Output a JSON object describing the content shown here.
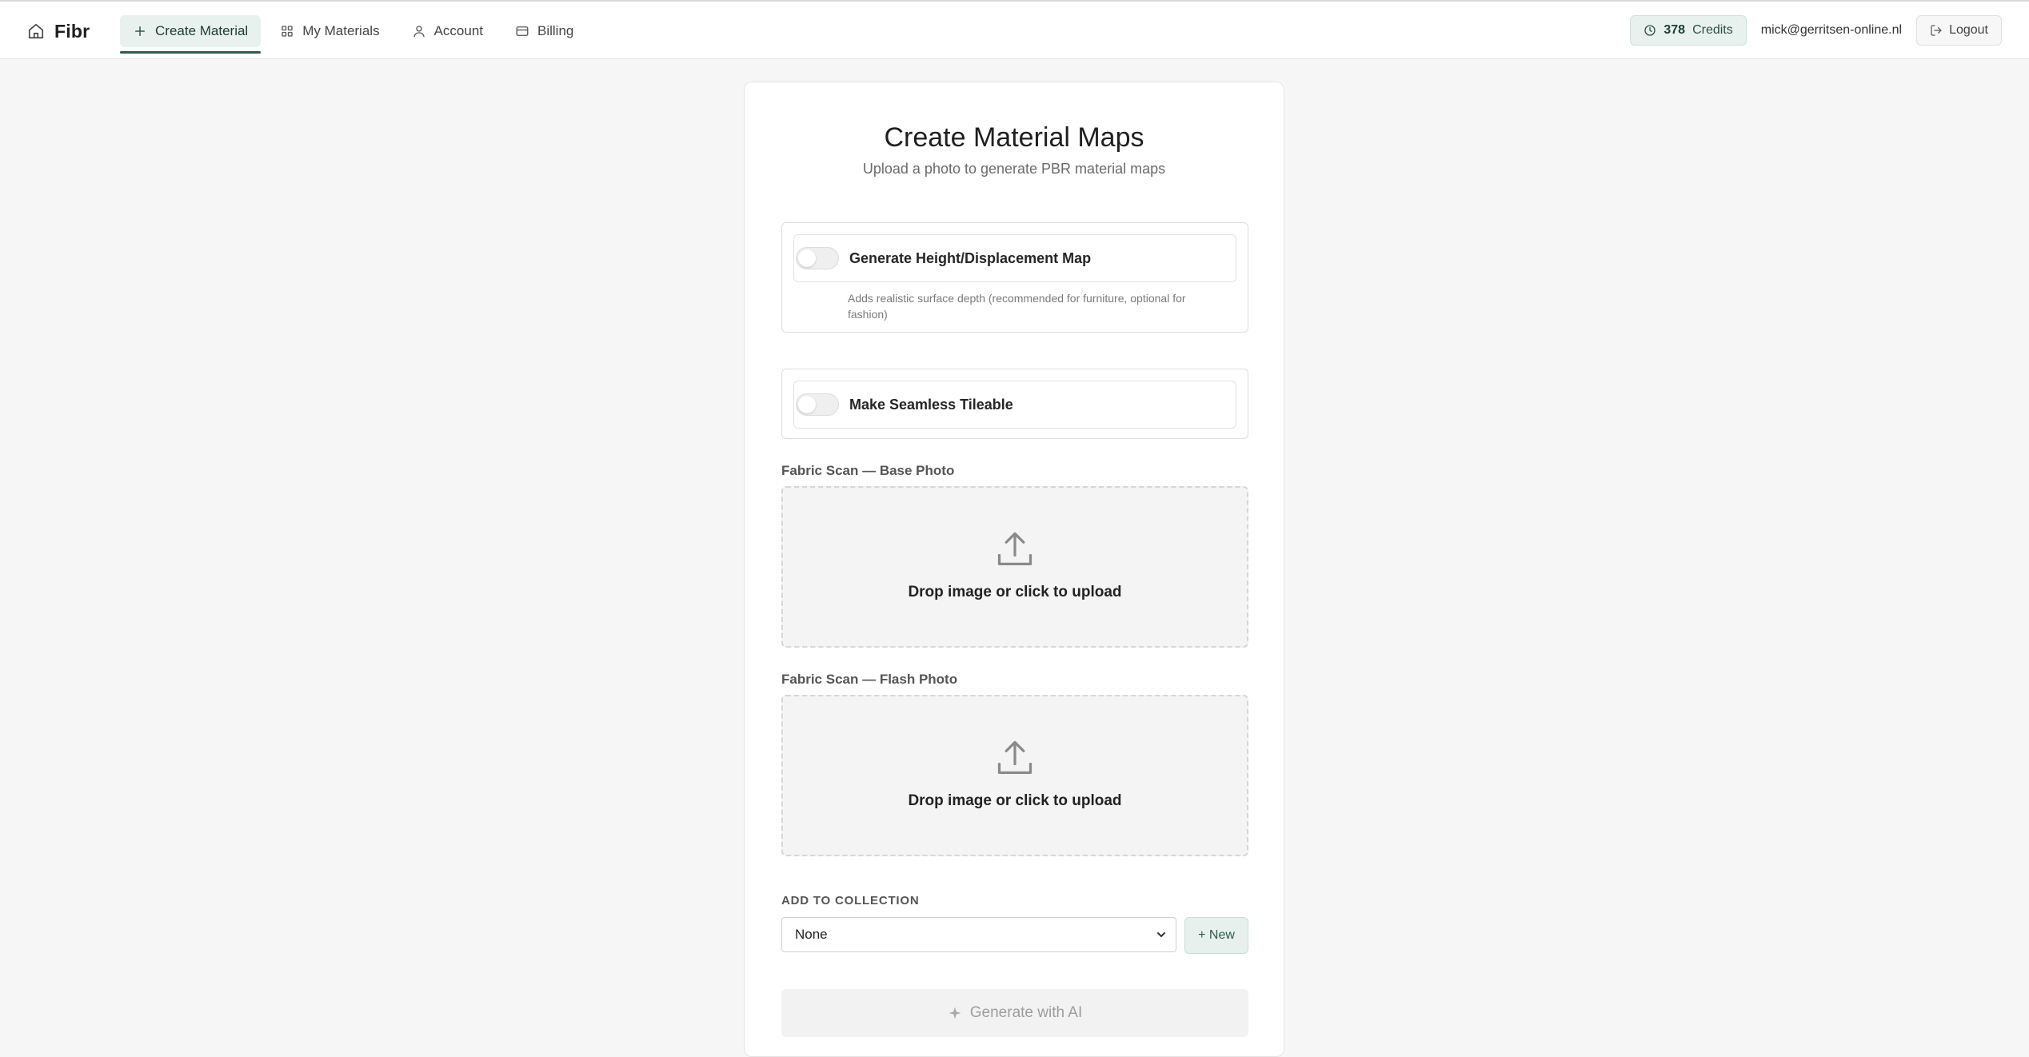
{
  "app": {
    "name": "Fibr"
  },
  "nav": {
    "items": [
      {
        "label": "Create Material",
        "icon": "plus-icon",
        "active": true
      },
      {
        "label": "My Materials",
        "icon": "grid-icon",
        "active": false
      },
      {
        "label": "Account",
        "icon": "user-icon",
        "active": false
      },
      {
        "label": "Billing",
        "icon": "credit-card-icon",
        "active": false
      }
    ]
  },
  "user": {
    "credits_count": "378",
    "credits_label": "Credits",
    "email": "mick@gerritsen-online.nl",
    "logout_label": "Logout"
  },
  "page": {
    "title": "Create Material Maps",
    "subtitle": "Upload a photo to generate PBR material maps"
  },
  "options": {
    "height_map": {
      "label": "Generate Height/Displacement Map",
      "description": "Adds realistic surface depth (recommended for furniture, optional for fashion)",
      "enabled": false
    },
    "seamless": {
      "label": "Make Seamless Tileable",
      "enabled": false
    }
  },
  "uploads": {
    "base": {
      "label": "Fabric Scan — Base Photo",
      "prompt": "Drop image or click to upload"
    },
    "flash": {
      "label": "Fabric Scan — Flash Photo",
      "prompt": "Drop image or click to upload"
    }
  },
  "collection": {
    "label": "ADD TO COLLECTION",
    "selected": "None",
    "new_label": "+ New"
  },
  "generate": {
    "label": "Generate with AI",
    "disabled": true
  },
  "colors": {
    "accent": "#2f5a4e",
    "accent_bg": "#e9f1ee",
    "page_bg": "#f6f6f6"
  }
}
